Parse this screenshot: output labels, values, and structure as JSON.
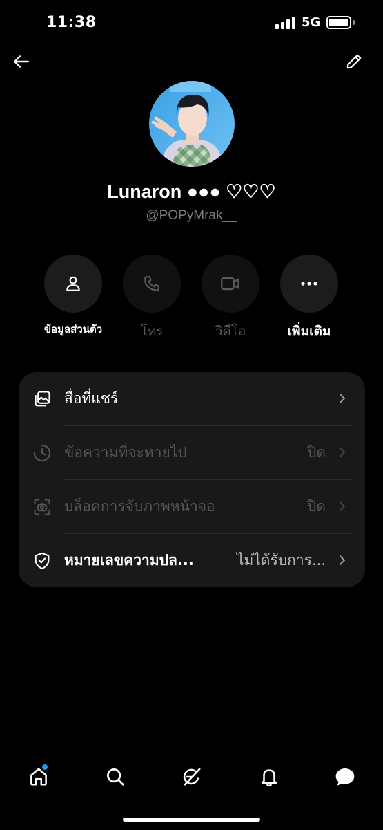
{
  "status_bar": {
    "time": "11:38",
    "network": "5G"
  },
  "nav": {
    "back_icon": "arrow-left-icon",
    "edit_icon": "pencil-icon"
  },
  "profile": {
    "display_name": "Lunaron ●●● ♡♡♡",
    "handle": "@POPyMrak__"
  },
  "actions": [
    {
      "label": "ข้อมูลส่วนตัว",
      "icon": "person-icon",
      "enabled": true
    },
    {
      "label": "โทร",
      "icon": "phone-icon",
      "enabled": false
    },
    {
      "label": "วิดีโอ",
      "icon": "video-icon",
      "enabled": false
    },
    {
      "label": "เพิ่มเติม",
      "icon": "more-icon",
      "enabled": true
    }
  ],
  "settings": [
    {
      "label": "สื่อที่แชร์",
      "value": "",
      "icon": "shared-media-icon",
      "enabled": true
    },
    {
      "label": "ข้อความที่จะหายไป",
      "value": "ปิด",
      "icon": "timer-icon",
      "enabled": false
    },
    {
      "label": "บล็อคการจับภาพหน้าจอ",
      "value": "ปิด",
      "icon": "screenshot-icon",
      "enabled": false
    },
    {
      "label": "หมายเลขความปล...",
      "value": "ไม่ได้รับการ...",
      "icon": "shield-check-icon",
      "enabled": true
    }
  ],
  "tabs": [
    {
      "name": "home",
      "icon": "home-icon",
      "has_badge": true
    },
    {
      "name": "search",
      "icon": "search-icon",
      "has_badge": false
    },
    {
      "name": "grok",
      "icon": "grok-icon",
      "has_badge": false
    },
    {
      "name": "notifications",
      "icon": "bell-icon",
      "has_badge": false
    },
    {
      "name": "messages",
      "icon": "message-icon",
      "has_badge": false
    }
  ],
  "colors": {
    "background": "#000000",
    "card": "#191919",
    "accent_dot": "#1d9bf0",
    "muted_text": "#7c7c7c"
  }
}
